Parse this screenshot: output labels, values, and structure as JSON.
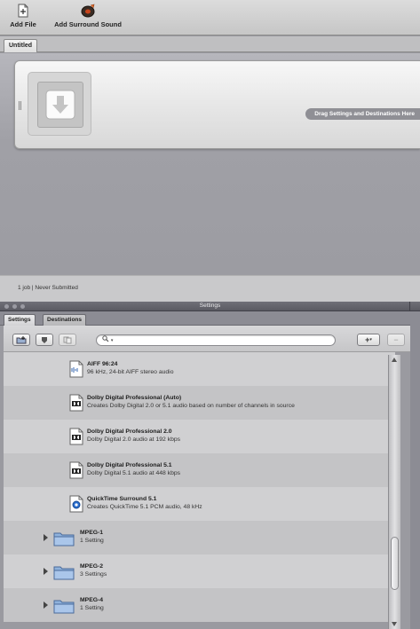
{
  "toolbar": {
    "add_file_label": "Add File",
    "add_surround_label": "Add Surround Sound"
  },
  "batch": {
    "tab_label": "Untitled",
    "drop_hint": "Drag Settings and Destinations Here"
  },
  "status": {
    "text": "1 job  |  Never Submitted"
  },
  "settings_window": {
    "title": "Settings",
    "tabs": [
      "Settings",
      "Destinations"
    ],
    "search_placeholder": "",
    "items": [
      {
        "kind": "setting",
        "icon": "aiff-file-icon",
        "title": "AIFF 96:24",
        "subtitle": "96 kHz, 24-bit AIFF stereo audio"
      },
      {
        "kind": "setting",
        "icon": "dolby-file-icon",
        "title": "Dolby Digital Professional (Auto)",
        "subtitle": "Creates Dolby Digital 2.0 or 5.1 audio based on number of channels in source"
      },
      {
        "kind": "setting",
        "icon": "dolby-file-icon",
        "title": "Dolby Digital Professional 2.0",
        "subtitle": "Dolby Digital 2.0 audio at 192 kbps"
      },
      {
        "kind": "setting",
        "icon": "dolby-file-icon",
        "title": "Dolby Digital Professional 5.1",
        "subtitle": "Dolby Digital 5.1 audio at 448 kbps"
      },
      {
        "kind": "setting",
        "icon": "quicktime-file-icon",
        "title": "QuickTime Surround 5.1",
        "subtitle": "Creates QuickTime 5.1 PCM audio, 48 kHz"
      },
      {
        "kind": "group",
        "icon": "folder-icon",
        "title": "MPEG-1",
        "subtitle": "1 Setting"
      },
      {
        "kind": "group",
        "icon": "folder-icon",
        "title": "MPEG-2",
        "subtitle": "3 Settings"
      },
      {
        "kind": "group",
        "icon": "folder-icon",
        "title": "MPEG-4",
        "subtitle": "1 Setting"
      }
    ]
  }
}
